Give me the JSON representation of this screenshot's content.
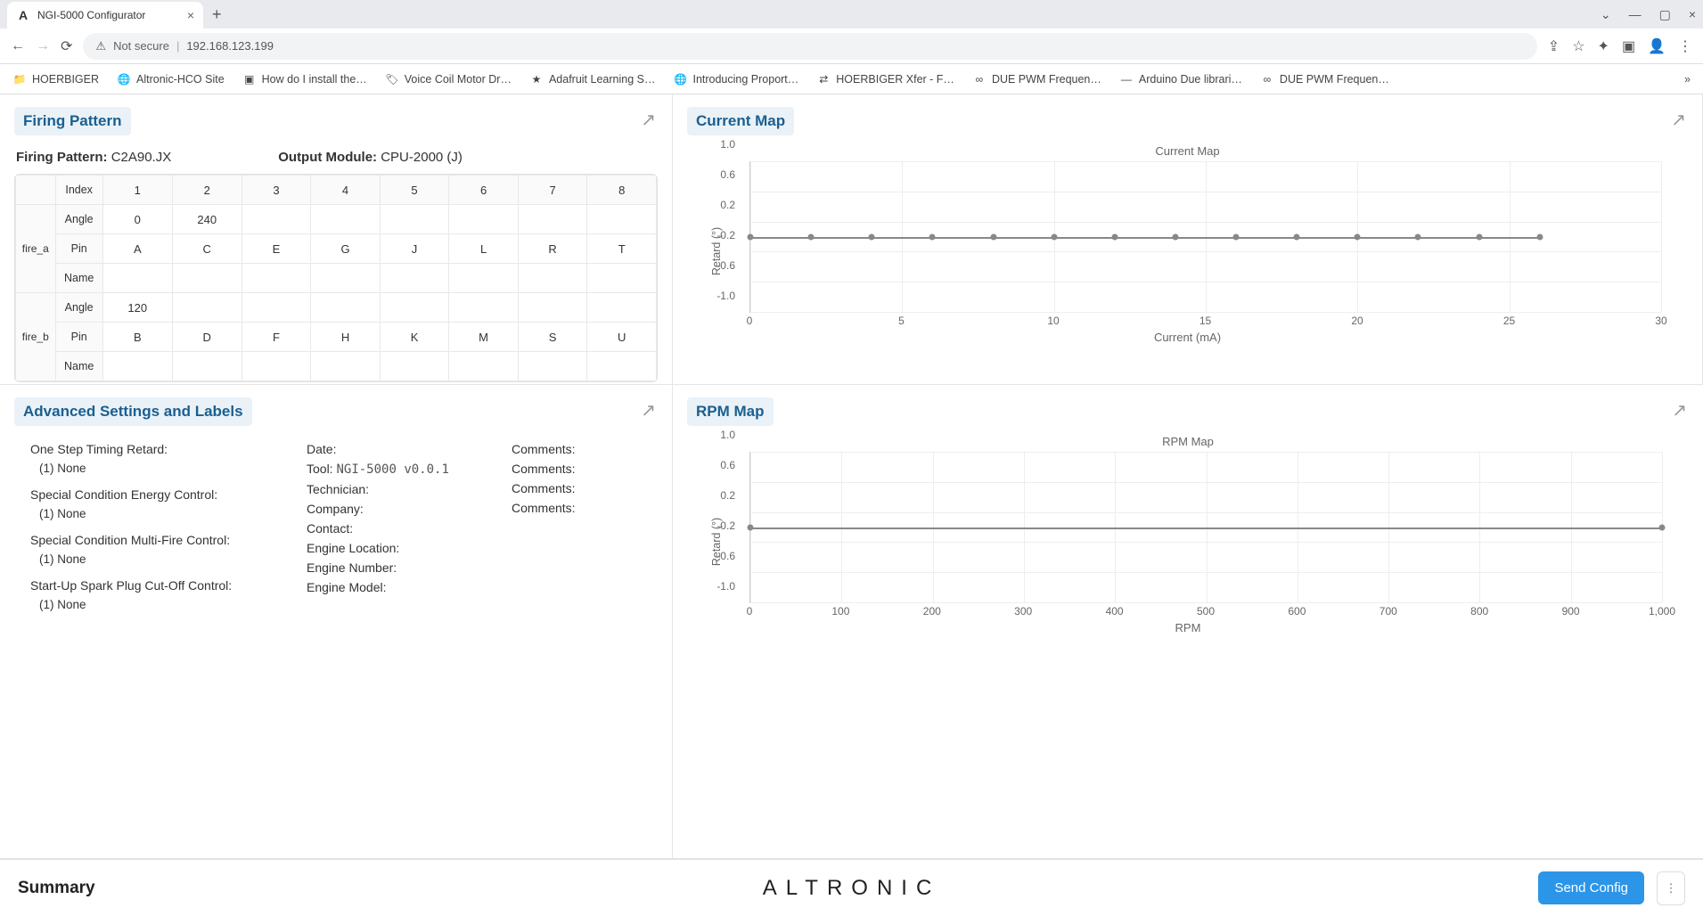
{
  "browser": {
    "tab_title": "NGI-5000 Configurator",
    "url_insecure_label": "Not secure",
    "url": "192.168.123.199"
  },
  "bookmarks": [
    {
      "label": "HOERBIGER",
      "icon": "folder"
    },
    {
      "label": "Altronic-HCO Site",
      "icon": "globe"
    },
    {
      "label": "How do I install the…",
      "icon": "sq"
    },
    {
      "label": "Voice Coil Motor Dr…",
      "icon": "tag"
    },
    {
      "label": "Adafruit Learning S…",
      "icon": "star"
    },
    {
      "label": "Introducing Proport…",
      "icon": "globe"
    },
    {
      "label": "HOERBIGER Xfer - F…",
      "icon": "xfer"
    },
    {
      "label": "DUE PWM Frequen…",
      "icon": "inf"
    },
    {
      "label": "Arduino Due librari…",
      "icon": "dash"
    },
    {
      "label": "DUE PWM Frequen…",
      "icon": "inf"
    }
  ],
  "firing_pattern": {
    "title": "Firing Pattern",
    "pattern_label": "Firing Pattern:",
    "pattern_value": "C2A90.JX",
    "output_label": "Output Module:",
    "output_value": "CPU-2000 (J)",
    "index_label": "Index",
    "indices": [
      "1",
      "2",
      "3",
      "4",
      "5",
      "6",
      "7",
      "8"
    ],
    "groups": [
      {
        "name": "fire_a",
        "rows": [
          {
            "label": "Angle",
            "cells": [
              "0",
              "240",
              "",
              "",
              "",
              "",
              "",
              ""
            ]
          },
          {
            "label": "Pin",
            "cells": [
              "A",
              "C",
              "E",
              "G",
              "J",
              "L",
              "R",
              "T"
            ]
          },
          {
            "label": "Name",
            "cells": [
              "",
              "",
              "",
              "",
              "",
              "",
              "",
              ""
            ]
          }
        ]
      },
      {
        "name": "fire_b",
        "rows": [
          {
            "label": "Angle",
            "cells": [
              "120",
              "",
              "",
              "",
              "",
              "",
              "",
              ""
            ]
          },
          {
            "label": "Pin",
            "cells": [
              "B",
              "D",
              "F",
              "H",
              "K",
              "M",
              "S",
              "U"
            ]
          },
          {
            "label": "Name",
            "cells": [
              "",
              "",
              "",
              "",
              "",
              "",
              "",
              ""
            ]
          }
        ]
      }
    ]
  },
  "advanced": {
    "title": "Advanced Settings and Labels",
    "left": [
      {
        "label": "One Step Timing Retard:",
        "sub": "(1) None"
      },
      {
        "label": "Special Condition Energy Control:",
        "sub": "(1) None"
      },
      {
        "label": "Special Condition Multi-Fire Control:",
        "sub": "(1) None"
      },
      {
        "label": "Start-Up Spark Plug Cut-Off Control:",
        "sub": "(1) None"
      }
    ],
    "mid": [
      {
        "label": "Date:",
        "value": ""
      },
      {
        "label": "Tool:",
        "value": "NGI-5000 v0.0.1",
        "mono": true
      },
      {
        "label": "Technician:",
        "value": ""
      },
      {
        "label": "Company:",
        "value": ""
      },
      {
        "label": "Contact:",
        "value": ""
      },
      {
        "label": "Engine Location:",
        "value": ""
      },
      {
        "label": "Engine Number:",
        "value": ""
      },
      {
        "label": "Engine Model:",
        "value": ""
      }
    ],
    "right": [
      {
        "label": "Comments:",
        "value": ""
      },
      {
        "label": "Comments:",
        "value": ""
      },
      {
        "label": "Comments:",
        "value": ""
      },
      {
        "label": "Comments:",
        "value": ""
      }
    ]
  },
  "current_map": {
    "title": "Current Map"
  },
  "rpm_map": {
    "title": "RPM Map"
  },
  "footer": {
    "summary": "Summary",
    "logo": "ALTRONIC",
    "send": "Send Config"
  },
  "chart_data": [
    {
      "type": "line",
      "title": "Current Map",
      "xlabel": "Current (mA)",
      "ylabel": "Retard (°)",
      "xlim": [
        0,
        30
      ],
      "ylim": [
        -1.0,
        1.0
      ],
      "y_ticks": [
        -1.0,
        -0.6,
        -0.2,
        0.2,
        0.6,
        1.0
      ],
      "x_ticks": [
        0,
        5,
        10,
        15,
        20,
        25,
        30
      ],
      "series": [
        {
          "name": "retard",
          "x": [
            0,
            2,
            4,
            6,
            8,
            10,
            12,
            14,
            16,
            18,
            20,
            22,
            24,
            26
          ],
          "y": [
            0,
            0,
            0,
            0,
            0,
            0,
            0,
            0,
            0,
            0,
            0,
            0,
            0,
            0
          ]
        }
      ]
    },
    {
      "type": "line",
      "title": "RPM Map",
      "xlabel": "RPM",
      "ylabel": "Retard (°)",
      "xlim": [
        0,
        1000
      ],
      "ylim": [
        -1.0,
        1.0
      ],
      "y_ticks": [
        -1.0,
        -0.6,
        -0.2,
        0.2,
        0.6,
        1.0
      ],
      "x_ticks": [
        0,
        100,
        200,
        300,
        400,
        500,
        600,
        700,
        800,
        900,
        1000
      ],
      "series": [
        {
          "name": "retard",
          "x": [
            0,
            1000
          ],
          "y": [
            0,
            0
          ]
        }
      ]
    }
  ]
}
